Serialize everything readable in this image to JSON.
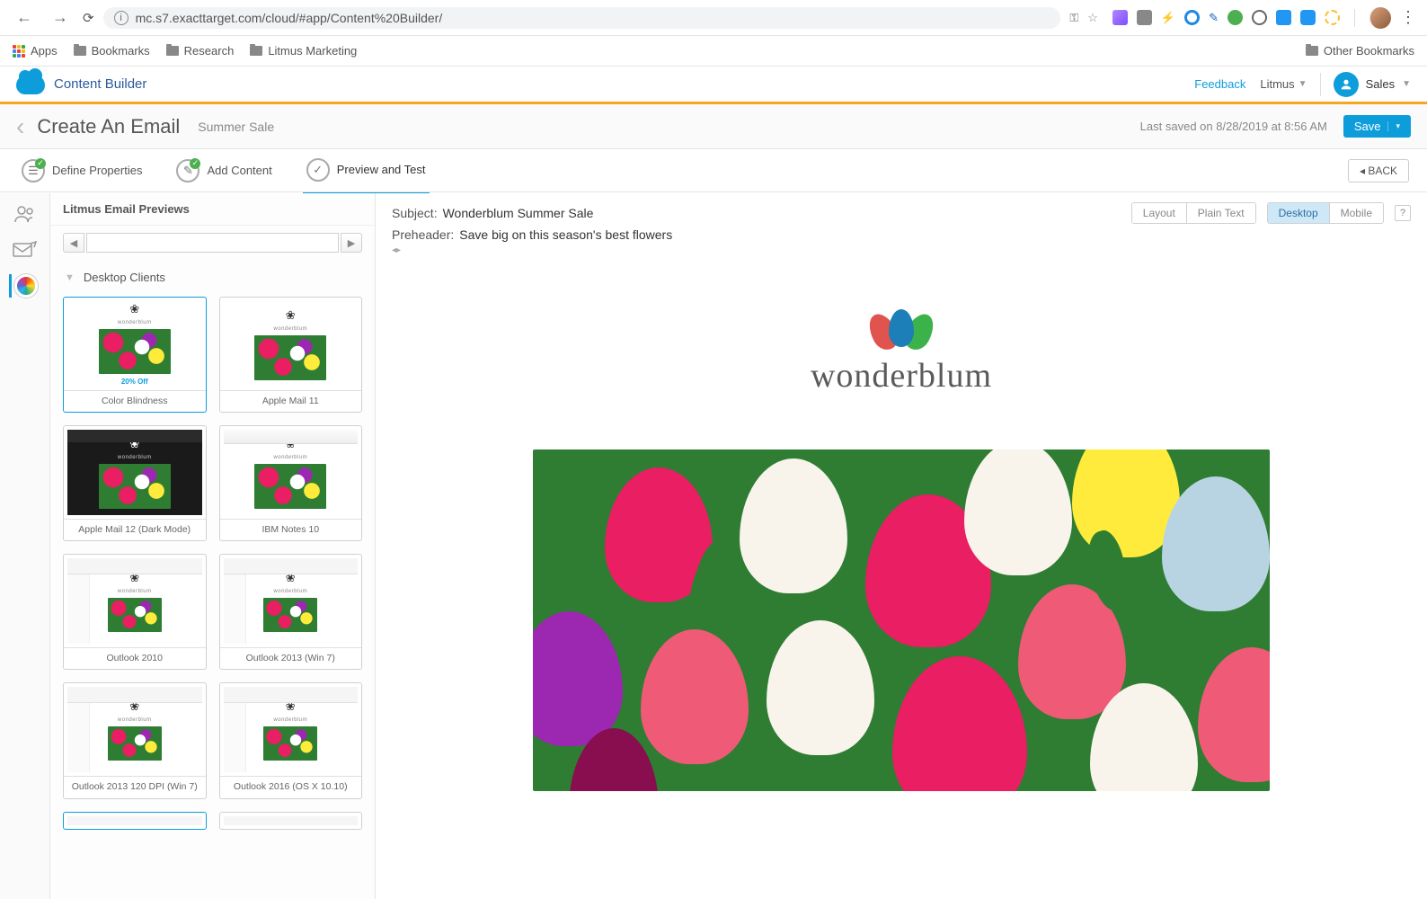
{
  "browser": {
    "url": "mc.s7.exacttarget.com/cloud/#app/Content%20Builder/",
    "bookmarks": [
      "Apps",
      "Bookmarks",
      "Research",
      "Litmus Marketing"
    ],
    "other_bookmarks": "Other Bookmarks"
  },
  "app": {
    "title": "Content Builder",
    "feedback": "Feedback",
    "org": "Litmus",
    "user": "Sales"
  },
  "page": {
    "title": "Create An Email",
    "doc_name": "Summer Sale",
    "last_saved": "Last saved on 8/28/2019 at 8:56 AM",
    "save": "Save"
  },
  "steps": {
    "define": "Define Properties",
    "add": "Add Content",
    "preview": "Preview and Test",
    "back": "BACK"
  },
  "previews": {
    "panel_title": "Litmus Email Previews",
    "section": "Desktop Clients",
    "promo": "20% Off",
    "thumbs": [
      {
        "label": "Color Blindness"
      },
      {
        "label": "Apple Mail 11"
      },
      {
        "label": "Apple Mail 12 (Dark Mode)"
      },
      {
        "label": "IBM Notes 10"
      },
      {
        "label": "Outlook 2010"
      },
      {
        "label": "Outlook 2013 (Win 7)"
      },
      {
        "label": "Outlook 2013 120 DPI (Win 7)"
      },
      {
        "label": "Outlook 2016 (OS X 10.10)"
      }
    ]
  },
  "email": {
    "subject_label": "Subject:",
    "subject": "Wonderblum Summer Sale",
    "preheader_label": "Preheader:",
    "preheader": "Save big on this season's best flowers",
    "view_layout": "Layout",
    "view_plain": "Plain Text",
    "device_desktop": "Desktop",
    "device_mobile": "Mobile",
    "brand": "wonderblum"
  }
}
